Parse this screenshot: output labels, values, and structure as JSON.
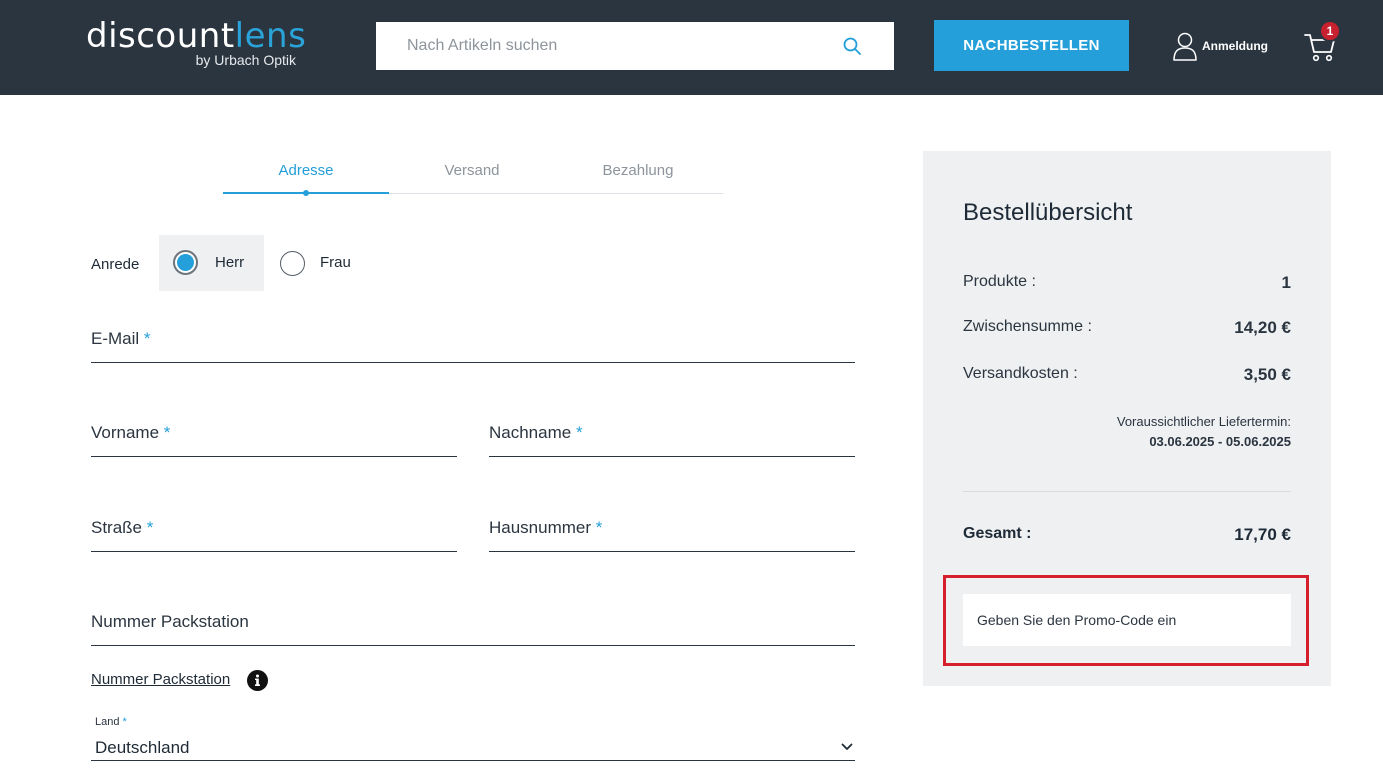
{
  "header": {
    "logo_main": "discount",
    "logo_accent": "lens",
    "logo_sub": "by Urbach Optik",
    "search_placeholder": "Nach Artikeln suchen",
    "reorder_label": "NACHBESTELLEN",
    "login_label": "Anmeldung",
    "cart_count": "1"
  },
  "steps": [
    {
      "label": "Adresse",
      "active": true
    },
    {
      "label": "Versand",
      "active": false
    },
    {
      "label": "Bezahlung",
      "active": false
    }
  ],
  "form": {
    "salutation_label": "Anrede",
    "salutation_options": [
      {
        "label": "Herr",
        "checked": true
      },
      {
        "label": "Frau",
        "checked": false
      }
    ],
    "required_marker": "*",
    "email_label": "E-Mail",
    "firstname_label": "Vorname",
    "lastname_label": "Nachname",
    "street_label": "Straße",
    "housenumber_label": "Hausnummer",
    "packstation_label": "Nummer Packstation",
    "packstation_link": "Nummer Packstation",
    "country_label": "Land",
    "country_value": "Deutschland"
  },
  "summary": {
    "title": "Bestellübersicht",
    "rows": [
      {
        "key": "Produkte :",
        "value": "1"
      },
      {
        "key": "Zwischensumme :",
        "value": "14,20 €"
      },
      {
        "key": "Versandkosten :",
        "value": "3,50 €"
      }
    ],
    "delivery_label": "Voraussichtlicher Liefertermin:",
    "delivery_dates": "03.06.2025 - 05.06.2025",
    "total_key": "Gesamt :",
    "total_value": "17,70 €",
    "promo_placeholder": "Geben Sie den Promo-Code ein"
  },
  "colors": {
    "header_bg": "#2b3540",
    "accent": "#249fd9",
    "badge": "#c7202f",
    "highlight": "#d61f2c",
    "summary_bg": "#eef0f2"
  },
  "icons": [
    "search-icon",
    "user-icon",
    "cart-icon",
    "info-icon",
    "chevron-down-icon"
  ]
}
